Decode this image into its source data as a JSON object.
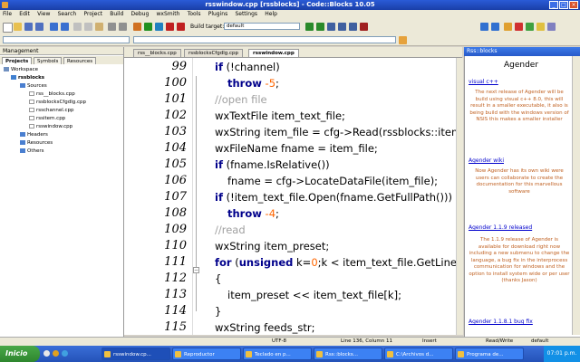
{
  "window": {
    "title": "rsswindow.cpp [rssblocks] - Code::Blocks 10.05"
  },
  "menu": [
    "File",
    "Edit",
    "View",
    "Search",
    "Project",
    "Build",
    "Debug",
    "wxSmith",
    "Tools",
    "Plugins",
    "Settings",
    "Help"
  ],
  "toolbar": {
    "build_target_label": "Build target:",
    "build_target_value": "default"
  },
  "management": {
    "title": "Management",
    "tabs": [
      "Projects",
      "Symbols",
      "Resources"
    ],
    "tree": [
      "Workspace",
      "rssblocks",
      "Sources",
      "rss__blocks.cpp",
      "rssblocksCfgdlg.cpp",
      "rsschannel.cpp",
      "rssitem.cpp",
      "rsswindow.cpp",
      "Headers",
      "Resources",
      "Others"
    ]
  },
  "editor": {
    "tabs": [
      "rss__blocks.cpp",
      "rssblocksCfgdlg.cpp",
      "rsswindow.cpp"
    ],
    "line_numbers": [
      "99",
      "100",
      "101",
      "102",
      "103",
      "104",
      "105",
      "106",
      "107",
      "108",
      "109",
      "110",
      "111",
      "112",
      "113",
      "114",
      "115"
    ],
    "lines": [
      [
        "if (!channel)"
      ],
      [
        "throw -5;"
      ],
      [
        "//open file"
      ],
      [
        "wxTextFile item_text_file;"
      ],
      [
        "wxString item_file = cfg->Read(rssblocks::itemf"
      ],
      [
        "wxFileName fname = item_file;"
      ],
      [
        "if (fname.IsRelative())"
      ],
      [
        "fname = cfg->LocateDataFile(item_file);"
      ],
      [
        "if (!item_text_file.Open(fname.GetFullPath()))"
      ],
      [
        "throw -4;"
      ],
      [
        "//read"
      ],
      [
        "wxString item_preset;"
      ],
      [
        "for (unsigned k=0;k < item_text_file.GetLineC"
      ],
      [
        "{"
      ],
      [
        "item_preset << item_text_file[k];"
      ],
      [
        "}"
      ],
      [
        "wxString feeds_str;"
      ]
    ]
  },
  "rss_panel": {
    "title": "Rss::blocks",
    "heading": "Agender",
    "items": [
      {
        "link": "visual c++",
        "text": "The next release of Agender will be build using visual c++ 8.0, this will result in a smaller executable, it also is being build with the windows version of NSIS this makes a smaller installer"
      },
      {
        "link": "Agender wiki",
        "text": "Now Agender has its own wiki were users can collaborate to create the documentation for this marvellous software"
      },
      {
        "link": "Agender 1.1.9 released",
        "text": "The 1.1.9 release of Agender is available for download right now including a new submenu to change the language, a bug fix in the interprocess communication for windows and the option to install system wide or per user (thanks Jason)"
      },
      {
        "link": "Agender 1.1.8.1 bug fix",
        "text": ""
      }
    ]
  },
  "statusbar": {
    "encoding": "UTF-8",
    "position": "Line 136, Column 11",
    "mode": "Insert",
    "rw": "Read/Write",
    "target": "default"
  },
  "taskbar": {
    "start": "Inicio",
    "tasks": [
      "rsswindow.cp...",
      "Reproductor",
      "Teclado en p...",
      "Rss::blocks...",
      "C:\\Archivos d...",
      "Programa de..."
    ],
    "clock": "07:01 p.m."
  },
  "colors": {
    "keyword": "#00008b",
    "comment": "#a0a0a0",
    "number": "#ff6600",
    "rss_text": "#c06020",
    "link": "#0000cc",
    "titlebar": "#1a3fa8"
  }
}
